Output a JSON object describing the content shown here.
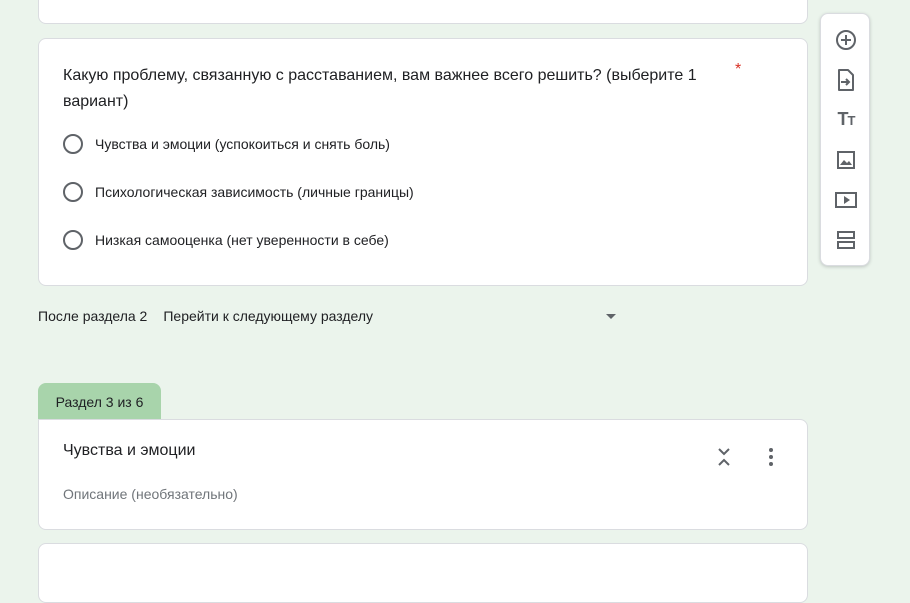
{
  "question": {
    "title": "Какую проблему, связанную с расставанием, вам важнее всего решить? (выберите 1 вариант)",
    "required_mark": "*",
    "options": [
      {
        "label": "Чувства и эмоции (успокоиться и снять боль)"
      },
      {
        "label": "Психологическая зависимость  (личные границы)"
      },
      {
        "label": "Низкая самооценка (нет уверенности в себе)"
      }
    ]
  },
  "navigation": {
    "after_label": "После раздела 2",
    "selected_value": "Перейти к следующему разделу"
  },
  "section": {
    "tab_label": "Раздел 3 из 6",
    "title": "Чувства и эмоции",
    "description_placeholder": "Описание (необязательно)"
  },
  "toolbar": {
    "items": [
      {
        "icon": "add-circle-icon"
      },
      {
        "icon": "import-question-icon"
      },
      {
        "icon": "title-text-icon"
      },
      {
        "icon": "image-icon"
      },
      {
        "icon": "video-icon"
      },
      {
        "icon": "section-icon"
      }
    ]
  },
  "colors": {
    "page_background": "#ebf4ec",
    "section_tab": "#a8d4ab",
    "required": "#d93025",
    "icon": "#5f6368"
  }
}
